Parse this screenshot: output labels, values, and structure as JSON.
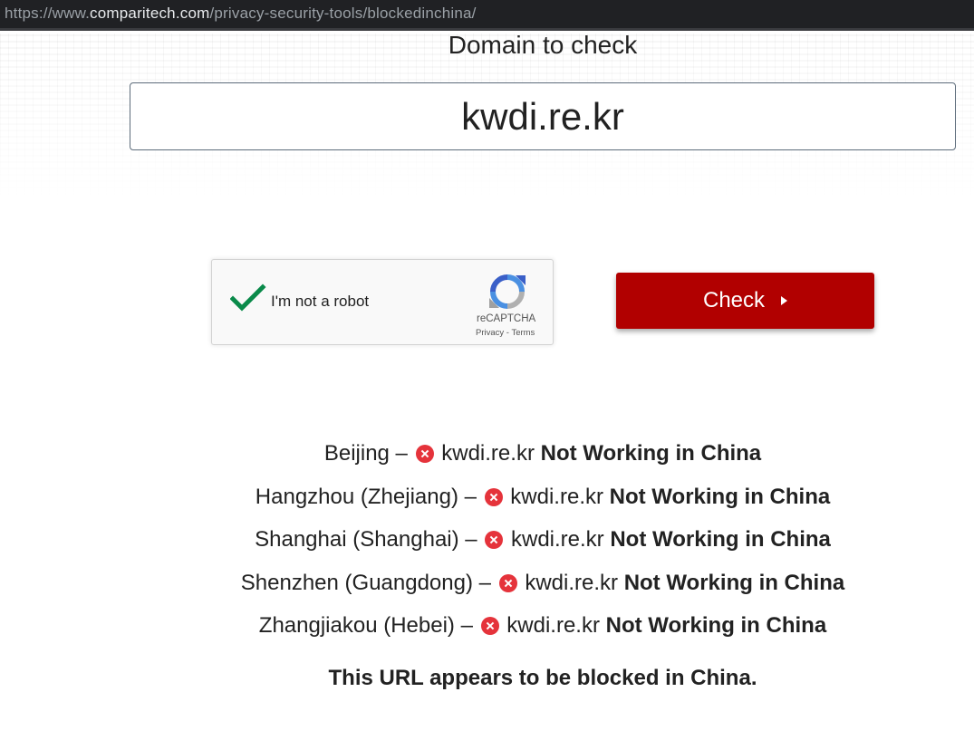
{
  "browser": {
    "url_scheme": "https://www.",
    "url_host": "comparitech.com",
    "url_path": "/privacy-security-tools/blockedinchina/"
  },
  "form": {
    "label": "Domain to check",
    "domain_value": "kwdi.re.kr",
    "check_label": "Check"
  },
  "recaptcha": {
    "label": "I'm not a robot",
    "brand": "reCAPTCHA",
    "privacy": "Privacy",
    "separator": " - ",
    "terms": "Terms",
    "checked": true
  },
  "results": [
    {
      "location": "Beijing",
      "dash": " – ",
      "domain": "kwdi.re.kr",
      "status": "Not Working in China"
    },
    {
      "location": "Hangzhou (Zhejiang)",
      "dash": " – ",
      "domain": "kwdi.re.kr",
      "status": "Not Working in China"
    },
    {
      "location": "Shanghai (Shanghai)",
      "dash": " – ",
      "domain": "kwdi.re.kr",
      "status": "Not Working in China"
    },
    {
      "location": "Shenzhen (Guangdong)",
      "dash": " – ",
      "domain": "kwdi.re.kr",
      "status": "Not Working in China"
    },
    {
      "location": "Zhangjiakou (Hebei)",
      "dash": " – ",
      "domain": "kwdi.re.kr",
      "status": "Not Working in China"
    }
  ],
  "summary": "This URL appears to be blocked in China.",
  "colors": {
    "accent": "#b10000",
    "fail_icon": "#e5333b",
    "check_green": "#0a8a4a"
  },
  "icons": {
    "status_icon": "fail-x-icon",
    "checkbox_icon": "checkmark-icon",
    "button_icon": "play-arrow-icon"
  }
}
